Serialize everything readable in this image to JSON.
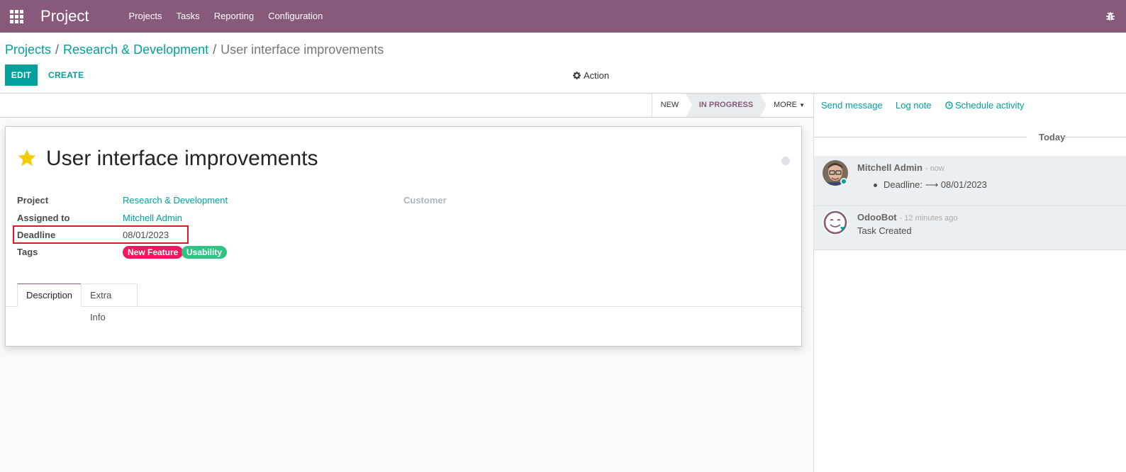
{
  "navbar": {
    "brand": "Project",
    "menu": [
      "Projects",
      "Tasks",
      "Reporting",
      "Configuration"
    ]
  },
  "breadcrumb": {
    "items": [
      "Projects",
      "Research & Development"
    ],
    "separator": "/",
    "current": "User interface improvements"
  },
  "toolbar": {
    "edit_label": "EDIT",
    "create_label": "CREATE",
    "action_label": "Action"
  },
  "statusbar": {
    "stages": [
      "NEW",
      "IN PROGRESS"
    ],
    "active_stage": "IN PROGRESS",
    "more_label": "MORE"
  },
  "task": {
    "title": "User interface improvements",
    "starred": true,
    "fields": {
      "project_label": "Project",
      "project_value": "Research & Development",
      "assigned_label": "Assigned to",
      "assigned_value": "Mitchell Admin",
      "deadline_label": "Deadline",
      "deadline_value": "08/01/2023",
      "tags_label": "Tags",
      "customer_label": "Customer"
    },
    "tags": [
      {
        "label": "New Feature",
        "color": "#f0195f"
      },
      {
        "label": "Usability",
        "color": "#30c381"
      }
    ],
    "tabs": [
      "Description",
      "Extra Info"
    ],
    "active_tab": "Description"
  },
  "chatter": {
    "buttons": [
      "Send message",
      "Log note",
      "Schedule activity"
    ],
    "date_separator": "Today",
    "messages": [
      {
        "author": "Mitchell Admin",
        "time": "- now",
        "body_label": "Deadline:",
        "body_arrow": "⟶",
        "body_value": "08/01/2023"
      },
      {
        "author": "OdooBot",
        "time": "- 12 minutes ago",
        "body": "Task Created"
      }
    ]
  },
  "colors": {
    "navbar": "#875a7b",
    "accent": "#00a09d",
    "highlight_box": "#e0191e"
  }
}
